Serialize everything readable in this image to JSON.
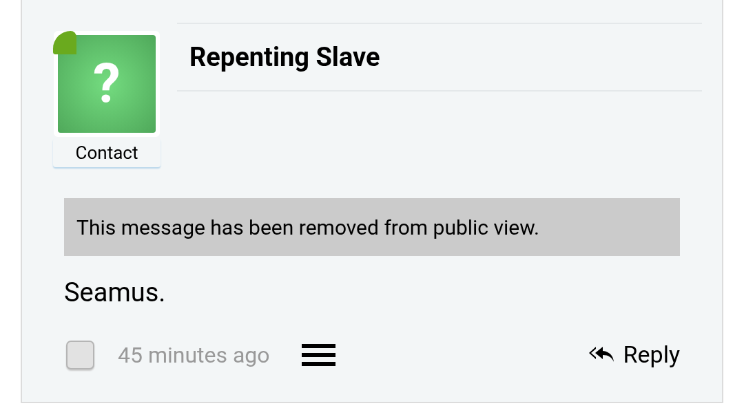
{
  "post": {
    "avatar": {
      "label": "Contact",
      "glyph": "?"
    },
    "author": "Repenting Slave",
    "notice": "This message has been removed from public view.",
    "body": "Seamus.",
    "footer": {
      "select": {
        "checked": false
      },
      "time": "45 minutes ago",
      "reply": "Reply"
    }
  }
}
